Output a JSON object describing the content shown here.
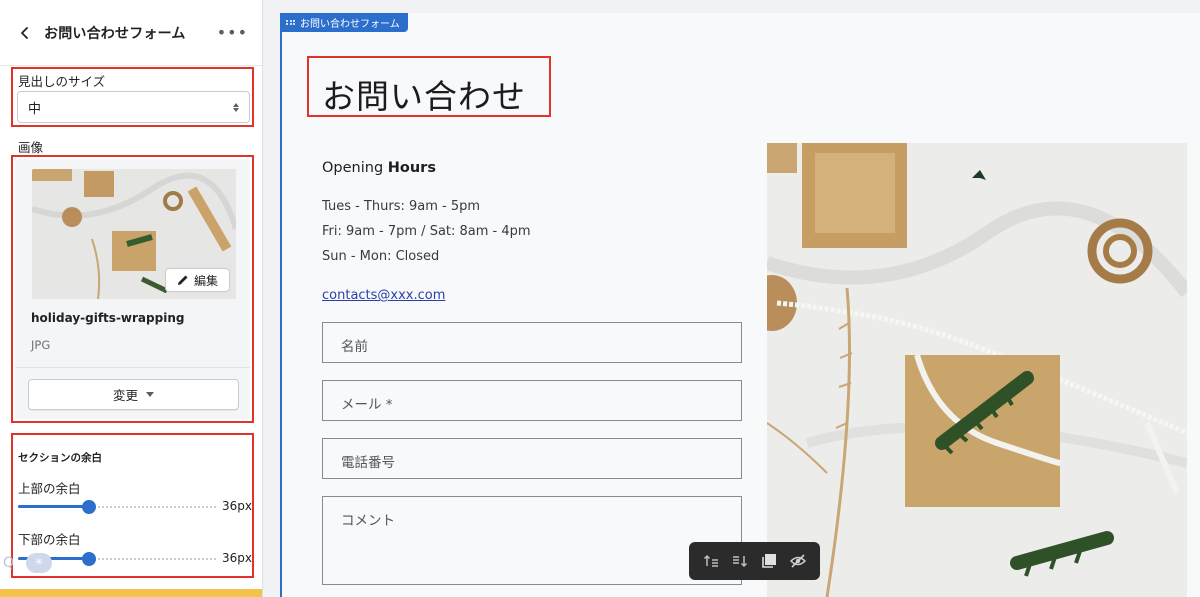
{
  "sidebar": {
    "title": "お問い合わせフォーム",
    "more": "•••",
    "heading_size": {
      "label": "見出しのサイズ",
      "value": "中"
    },
    "image": {
      "label": "画像",
      "edit_label": "編集",
      "file_name": "holiday-gifts-wrapping",
      "file_type": "JPG",
      "change_label": "変更"
    },
    "section_margin": {
      "title": "セクションの余白",
      "top": {
        "label": "上部の余白",
        "value": "36px",
        "level": 0.36
      },
      "bottom": {
        "label": "下部の余白",
        "value": "36px",
        "level": 0.36
      }
    },
    "overlay": {
      "q": "Q"
    }
  },
  "preview": {
    "section_tag": "お問い合わせフォーム",
    "heading": "お問い合わせ",
    "hours_title_prefix": "Opening",
    "hours_title_bold": "Hours",
    "hours": [
      "Tues - Thurs: 9am - 5pm",
      "Fri: 9am - 7pm / Sat: 8am - 4pm",
      "Sun - Mon: Closed"
    ],
    "email": "contacts@xxx.com",
    "fields": {
      "name": "名前",
      "mail": "メール *",
      "phone": "電話番号",
      "comment": "コメント"
    }
  },
  "toolbar": {
    "icons": [
      "move-up-icon",
      "move-down-icon",
      "duplicate-icon",
      "hide-icon"
    ]
  },
  "colors": {
    "accent": "#2c6ecb",
    "highlight_border": "#e0342a",
    "toolbar_bg": "#2b2b2b",
    "toast": "#f5c34b"
  }
}
